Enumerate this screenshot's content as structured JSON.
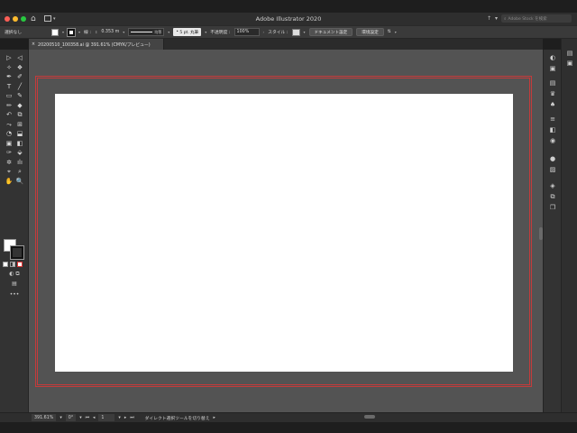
{
  "window": {
    "title": "Adobe Illustrator 2020",
    "traffic_light_colors": [
      "#ff5f57",
      "#febc2e",
      "#28c840"
    ]
  },
  "titlebar_right": {
    "arrange_icon": "↑",
    "search_placeholder": "Adobe Stock を検索"
  },
  "control_bar": {
    "selection_label": "選択なし",
    "stroke_label": "線 :",
    "stroke_weight": "0.353 m",
    "line_style": "均等",
    "brush": "5 pt. 丸筆",
    "opacity_label": "不透明度 :",
    "opacity_value": "100%",
    "style_label": "スタイル :",
    "document_setup_button": "ドキュメント設定",
    "preferences_button": "環境設定"
  },
  "document_tab": {
    "close_icon": "×",
    "title": "20200510_100358.ai @ 391.61% (CMYK/プレビュー)"
  },
  "status_bar": {
    "zoom": "391.61%",
    "rotation": "0°",
    "artboard_number": "1",
    "tool_hint": "ダイレクト選択ツールを切り替え"
  },
  "left_tools": [
    [
      "▷",
      "◁"
    ],
    [
      "✧",
      "❖"
    ],
    [
      "✒",
      "✐"
    ],
    [
      "T",
      "╱"
    ],
    [
      "▭",
      "✎"
    ],
    [
      "✏",
      "◆"
    ],
    [
      "↶",
      "⧉"
    ],
    [
      "⤳",
      "⊞"
    ],
    [
      "◔",
      "⬓"
    ],
    [
      "▣",
      "◧"
    ],
    [
      "✑",
      "⬙"
    ],
    [
      "✲",
      "ılı"
    ],
    [
      "⌖",
      "⌕"
    ],
    [
      "✋",
      "🔍"
    ]
  ],
  "right_panel_icons": [
    "◐",
    "▣",
    "▤",
    "♛",
    "♠",
    "≡",
    "◧",
    "◉",
    "●",
    "▨",
    "◈",
    "⧉",
    "❐"
  ],
  "far_right_icons": [
    "▤",
    "▣"
  ]
}
